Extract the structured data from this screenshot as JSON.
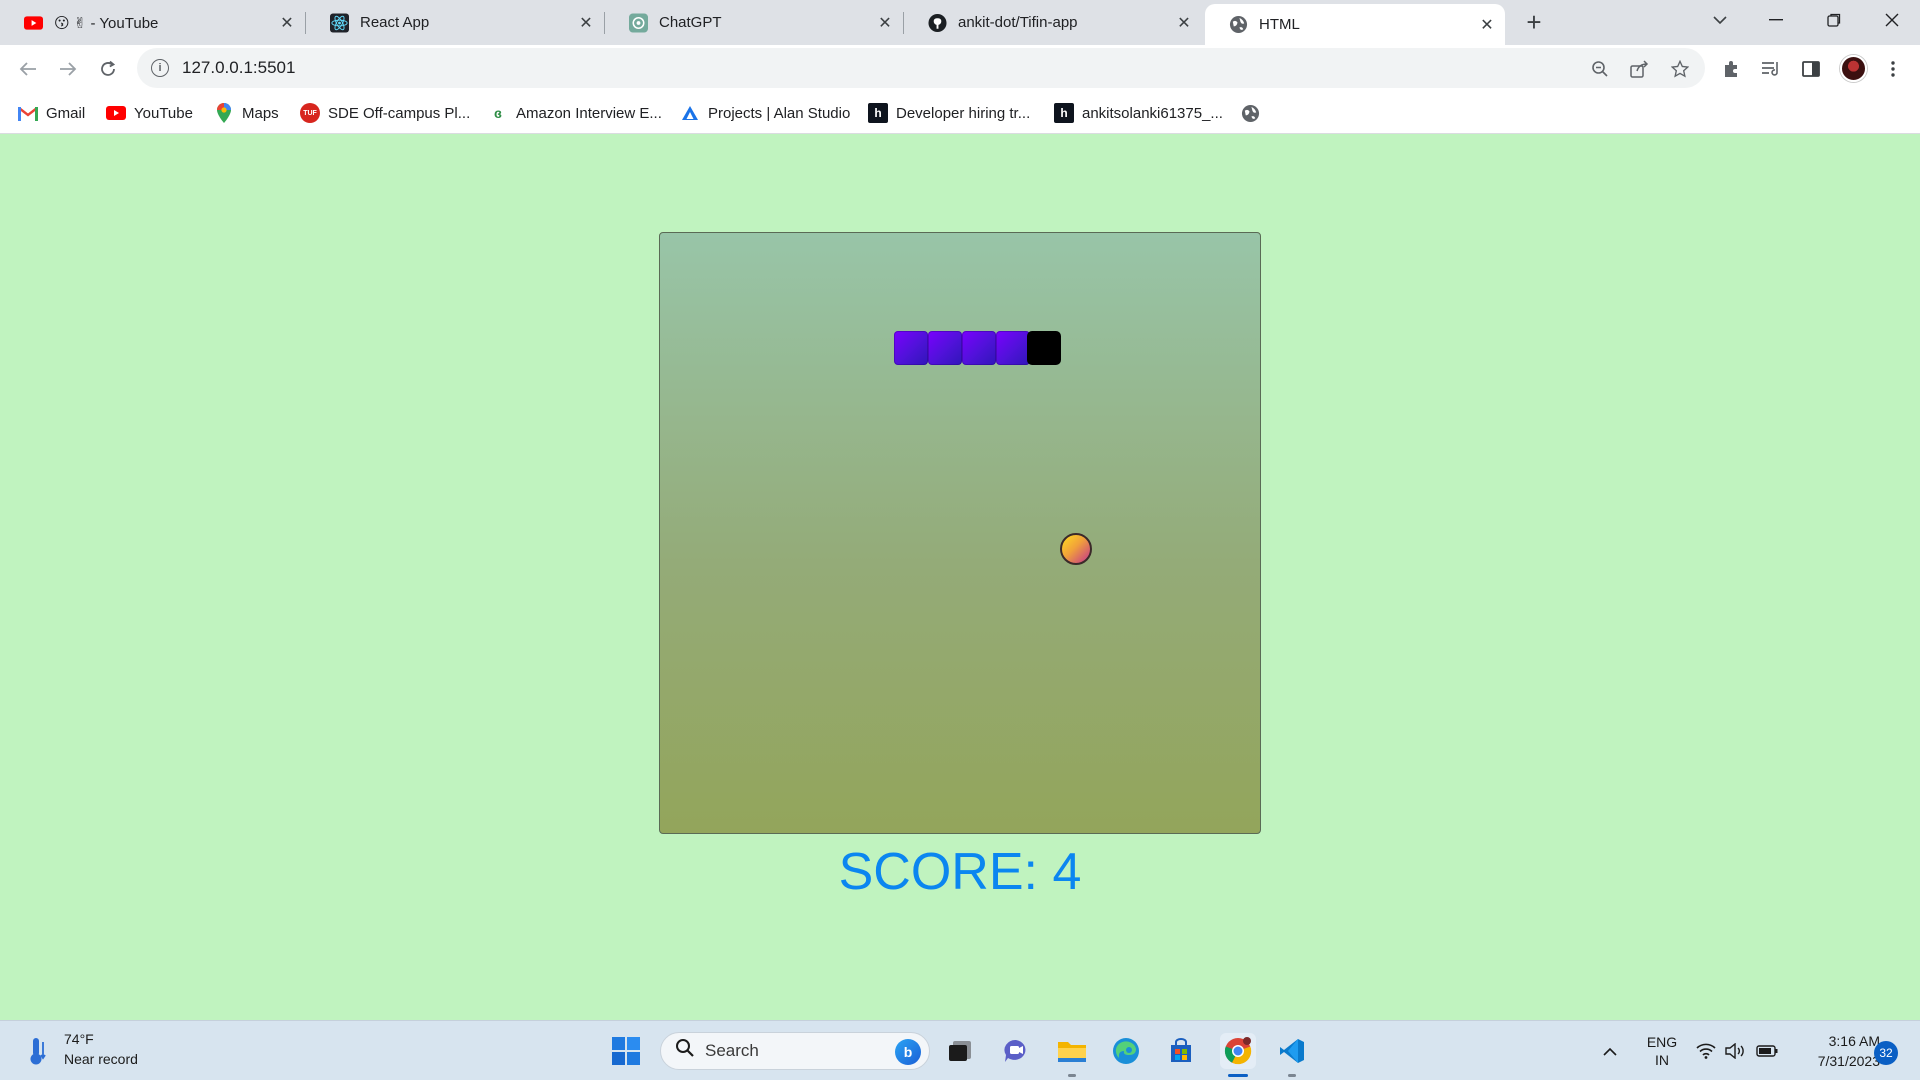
{
  "browser": {
    "tabs": [
      {
        "title": "😗 ✌ - YouTube",
        "icon": "youtube-icon",
        "active": false
      },
      {
        "title": "React App",
        "icon": "react-icon",
        "active": false
      },
      {
        "title": "ChatGPT",
        "icon": "chatgpt-icon",
        "active": false
      },
      {
        "title": "ankit-dot/Tifin-app",
        "icon": "github-icon",
        "active": false
      },
      {
        "title": "HTML",
        "icon": "globe-icon",
        "active": true
      }
    ],
    "url": "127.0.0.1:5501",
    "bookmarks": [
      {
        "label": "Gmail",
        "icon": "gmail-icon"
      },
      {
        "label": "YouTube",
        "icon": "youtube-icon"
      },
      {
        "label": "Maps",
        "icon": "maps-icon"
      },
      {
        "label": "SDE Off-campus Pl...",
        "icon": "tuf-icon"
      },
      {
        "label": "Amazon Interview E...",
        "icon": "geeksforgeeks-icon"
      },
      {
        "label": "Projects | Alan Studio",
        "icon": "alan-icon"
      },
      {
        "label": "Developer hiring tr...",
        "icon": "hackerrank-icon"
      },
      {
        "label": "ankitsolanki61375_...",
        "icon": "hackerrank-icon"
      }
    ]
  },
  "game": {
    "score_text": "SCORE: 4",
    "score": 4,
    "colors": {
      "board_top": "#98c5a8",
      "board_bottom": "#93a55b",
      "snake_body": "#5a10e0",
      "snake_head": "#000000",
      "score": "#0b86f0",
      "page_bg": "#c0f3bf"
    }
  },
  "taskbar": {
    "weather_temp": "74°F",
    "weather_desc": "Near record",
    "search_label": "Search",
    "language": "ENG",
    "region": "IN",
    "time": "3:16 AM",
    "date": "7/31/2023",
    "notification_count": "32"
  }
}
